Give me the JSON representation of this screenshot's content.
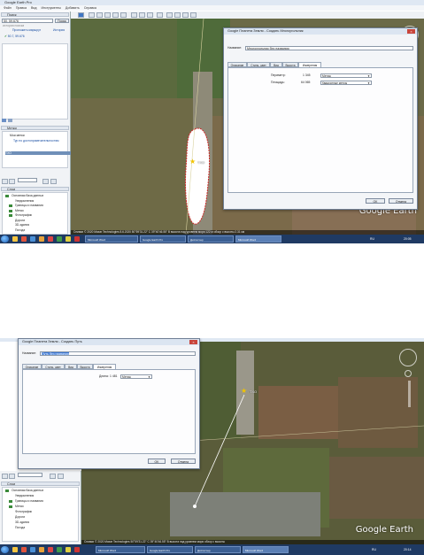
{
  "shot1": {
    "app_title": "Google Earth Pro",
    "menu": [
      "Файл",
      "Правка",
      "Вид",
      "Инструменты",
      "Добавить",
      "Справка"
    ],
    "search": {
      "header": "Поиск",
      "query": "50, 59.676",
      "search_button": "Поиск",
      "hint": "история поиска",
      "route_link": "Проложить маршрут",
      "history_link": "История",
      "result": "50.7, 59.676"
    },
    "places": {
      "header": "Метки",
      "items": [
        "Мои метки",
        "Тур по достопримечательностям",
        "ТХО"
      ]
    },
    "layers": {
      "header": "Слои",
      "items": [
        "Основная база данных",
        "Уведомления",
        "Границы и названия",
        "Метки",
        "Фотографии",
        "Дороги",
        "3D-здания",
        "Погода"
      ]
    },
    "dialog": {
      "title": "Google Планета Земля - Создать Многоугольник",
      "name_label": "Название:",
      "name_value": "Многоугольник без названия",
      "tabs": [
        "Описание",
        "Стиль, цвет",
        "Вид",
        "Высота",
        "Измерения"
      ],
      "active_tab": "Измерения",
      "perimeter_label": "Периметр:",
      "perimeter_value": "1 345",
      "perimeter_unit": "Метры",
      "area_label": "Площадь:",
      "area_value": "64 065",
      "area_unit": "Квадратные метры",
      "ok": "OK",
      "cancel": "Отмена"
    },
    "placemark_label": "ТХО",
    "status": "Снимки © 2020 Maxar Technologies 8.6.2020 50°59'31.22\" С 39°40'46.55\" В высота над уровнем моря 122 м обзор с высоты 2.31 км",
    "logo": "Google Earth",
    "taskbar": {
      "items": [
        "Microsoft Word",
        "Google Earth Pro",
        "Диспетчер",
        "Microsoft Word",
        "Google Earth Pro"
      ],
      "lang": "RU",
      "time": "20:05"
    }
  },
  "shot2": {
    "dialog": {
      "title": "Google Планета Земля - Создать Путь",
      "name_label": "Название:",
      "name_value": "Путь без названия",
      "tabs": [
        "Описание",
        "Стиль, цвет",
        "Вид",
        "Высота",
        "Измерения"
      ],
      "active_tab": "Измерения",
      "length_label": "Длина:",
      "length_value": "1 481",
      "length_unit": "Метры",
      "ok": "OK",
      "cancel": "Отмена"
    },
    "placemark_label": "ТХО",
    "layers": {
      "header": "Слои",
      "items": [
        "Основная база данных",
        "Уведомления",
        "Границы и названия",
        "Метки",
        "Фотографии",
        "Дороги",
        "3D-здания",
        "Погода"
      ]
    },
    "status": "Снимки © 2020 Maxar Technologies 50°59'31.22\" С 39°40'46.55\" В высота над уровнем моря обзор с высоты",
    "logo": "Google Earth",
    "taskbar": {
      "items": [
        "Microsoft Word",
        "Google Earth Pro",
        "Диспетчер",
        "Microsoft Word",
        "Google Earth Pro"
      ],
      "lang": "RU",
      "time": "20:14"
    }
  },
  "colors": {
    "taskbar": "#1f3a63",
    "dialog_bg": "#f3f5f8",
    "link": "#1a4fa3",
    "polygon_outline": "#d02a2a"
  }
}
